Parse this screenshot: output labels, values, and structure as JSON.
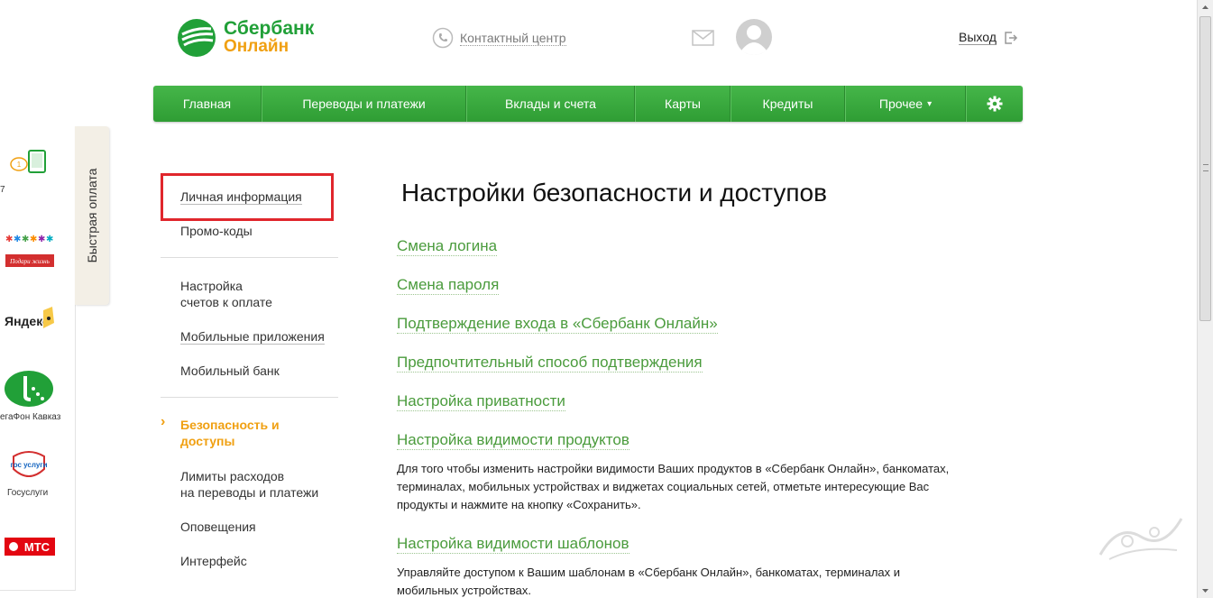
{
  "header": {
    "logo_line1": "Сбербанк",
    "logo_line2": "Онлайн",
    "contact_label": "Контактный центр",
    "logout_label": "Выход"
  },
  "nav": {
    "items": [
      {
        "label": "Главная"
      },
      {
        "label": "Переводы и платежи"
      },
      {
        "label": "Вклады и счета"
      },
      {
        "label": "Карты"
      },
      {
        "label": "Кредиты"
      },
      {
        "label": "Прочее"
      }
    ],
    "more_caret": "▾"
  },
  "quickpay": {
    "tab_label": "Быстрая оплата",
    "caption_1": "7",
    "kids_logo_text": "Подари жизнь",
    "yandex_logo_text": "Яндекс",
    "megafon_caption": "егаФон Кавказ",
    "gos_logo_text": "гос услуги",
    "gos_caption": "Госуслуги",
    "mts_logo_text": "МТС"
  },
  "leftmenu": {
    "personal_info": "Личная информация",
    "promo_codes": "Промо-коды",
    "bill_settings_1": "Настройка",
    "bill_settings_2": "счетов к оплате",
    "mobile_apps": "Мобильные приложения",
    "mobile_bank": "Мобильный банк",
    "active_arrow": "›",
    "security_1": "Безопасность и",
    "security_2": "доступы",
    "limits_1": "Лимиты расходов",
    "limits_2": "на переводы и платежи",
    "notifications": "Оповещения",
    "interface": "Интерфейс"
  },
  "content": {
    "title": "Настройки безопасности и доступов",
    "links": [
      {
        "label": "Смена логина"
      },
      {
        "label": "Смена пароля"
      },
      {
        "label": "Подтверждение входа в «Сбербанк Онлайн»"
      },
      {
        "label": "Предпочтительный способ подтверждения"
      },
      {
        "label": "Настройка приватности"
      },
      {
        "label": "Настройка видимости продуктов"
      },
      {
        "label": "Настройка видимости шаблонов"
      }
    ],
    "products_text_1": "Для того чтобы изменить настройки видимости Ваших продуктов в «Сбербанк Онлайн», банкоматах,",
    "products_text_2": "терминалах, мобильных устройствах и виджетах социальных сетей, отметьте интересующие Вас",
    "products_text_3": "продукты и нажмите на кнопку «Сохранить».",
    "templates_text_1": "Управляйте доступом к Вашим шаблонам в «Сбербанк Онлайн», банкоматах, терминалах и",
    "templates_text_2": "мобильных устройствах."
  },
  "colors": {
    "brand_green": "#21a038",
    "brand_orange": "#f0a012",
    "link_green": "#4a9b3c",
    "highlight_red": "#e0262c"
  },
  "icons": [
    "sberbank-logo-icon",
    "phone-icon",
    "mail-icon",
    "avatar-icon",
    "logout-icon",
    "gear-icon",
    "chevron-right-icon"
  ]
}
